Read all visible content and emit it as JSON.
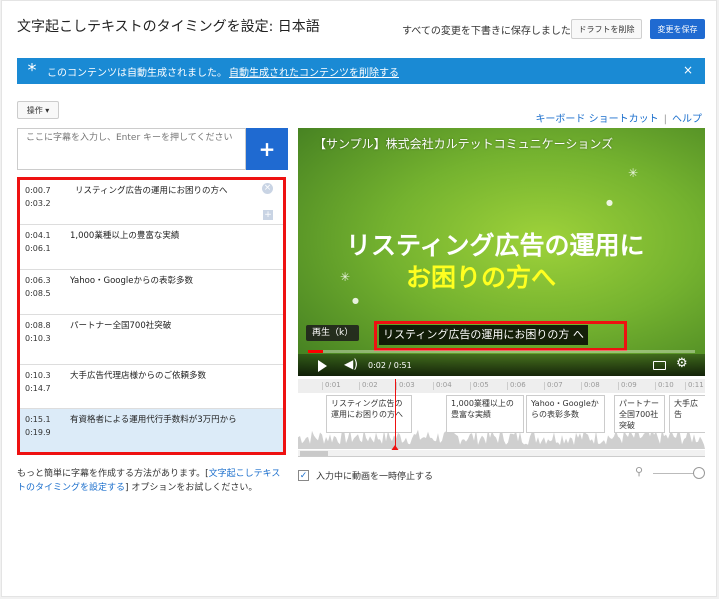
{
  "header": {
    "title": "文字起こしテキストのタイミングを設定: 日本語",
    "saved_message": "すべての変更を下書きに保存しました",
    "delete_draft_label": "ドラフトを削除",
    "save_label": "変更を保存"
  },
  "banner": {
    "message": "このコンテンツは自動生成されました。",
    "link": "自動生成されたコンテンツを削除する",
    "close": "×",
    "color": "#1a8ad4"
  },
  "toolbar": {
    "actions_label": "操作 ▾",
    "keyboard_shortcuts": "キーボード ショートカット",
    "separator": "|",
    "help": "ヘルプ"
  },
  "caption_input": {
    "placeholder": "ここに字幕を入力し、Enter キーを押してください",
    "add_button": "+"
  },
  "captions": [
    {
      "start": "0:00.7",
      "end": "0:03.2",
      "text": "リスティング広告の運用にお困りの方へ",
      "selected": false
    },
    {
      "start": "0:04.1",
      "end": "0:06.1",
      "text": "1,000業種以上の豊富な実績",
      "selected": false
    },
    {
      "start": "0:06.3",
      "end": "0:08.5",
      "text": "Yahoo・Googleからの表彰多数",
      "selected": false
    },
    {
      "start": "0:08.8",
      "end": "0:10.3",
      "text": "パートナー全国700社突破",
      "selected": false
    },
    {
      "start": "0:10.3",
      "end": "0:14.7",
      "text": "大手広告代理店様からのご依頼多数",
      "selected": false
    },
    {
      "start": "0:15.1",
      "end": "0:19.9",
      "text": "有資格者による運用代行手数料が3万円から",
      "selected": true
    }
  ],
  "help_text": {
    "prefix": "もっと簡単に字幕を作成する方法があります。[",
    "link": "文字起こしテキストのタイミングを設定する",
    "suffix": "] オプションをお試しください。"
  },
  "video": {
    "title": "【サンプル】株式会社カルテットコミュニケーションズ",
    "line1": "リスティング広告の運用に",
    "line2": "お困りの方へ",
    "caption": "リスティング広告の運用にお困りの方 へ",
    "tooltip": "再生（k）",
    "time": "0:02 / 0:51",
    "progress": 0.04
  },
  "timeline": {
    "ticks": [
      "0:01",
      "0:02",
      "0:03",
      "0:04",
      "0:05",
      "0:06",
      "0:07",
      "0:08",
      "0:09",
      "0:10",
      "0:11"
    ],
    "cues": [
      "リスティング広告の運用にお困りの方へ",
      "1,000業種以上の豊富な実績",
      "Yahoo・Googleからの表彰多数",
      "パートナー全国700社突破",
      "大手広告"
    ]
  },
  "options": {
    "pause_while_typing": "入力中に動画を一時停止する",
    "pause_checked": true
  },
  "colors": {
    "primary": "#1f6ad1",
    "highlight": "#e11111",
    "link": "#1a6ecc",
    "selected_row": "#dcebf8"
  }
}
